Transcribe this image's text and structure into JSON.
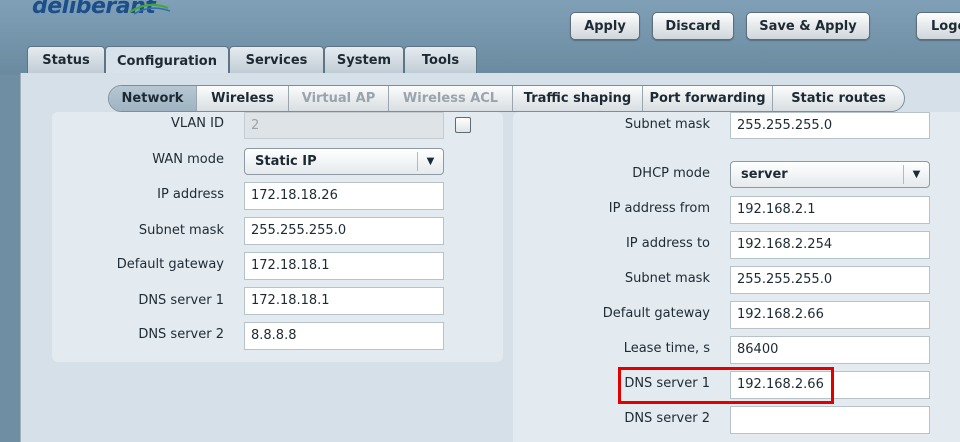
{
  "brand": {
    "logo_text": "deliberant"
  },
  "toolbar": {
    "apply_label": "Apply",
    "discard_label": "Discard",
    "save_apply_label": "Save & Apply",
    "logout_label": "Logo"
  },
  "main_tabs": [
    {
      "label": "Status"
    },
    {
      "label": "Configuration"
    },
    {
      "label": "Services"
    },
    {
      "label": "System"
    },
    {
      "label": "Tools"
    }
  ],
  "sub_tabs": [
    {
      "label": "Network"
    },
    {
      "label": "Wireless"
    },
    {
      "label": "Virtual AP"
    },
    {
      "label": "Wireless ACL"
    },
    {
      "label": "Traffic shaping"
    },
    {
      "label": "Port forwarding"
    },
    {
      "label": "Static routes"
    }
  ],
  "wan": {
    "vlan_id_label": "VLAN ID",
    "vlan_id_value": "2",
    "wan_mode_label": "WAN mode",
    "wan_mode_value": "Static IP",
    "ip_label": "IP address",
    "ip_value": "172.18.18.26",
    "mask_label": "Subnet mask",
    "mask_value": "255.255.255.0",
    "gateway_label": "Default gateway",
    "gateway_value": "172.18.18.1",
    "dns1_label": "DNS server 1",
    "dns1_value": "172.18.18.1",
    "dns2_label": "DNS server 2",
    "dns2_value": "8.8.8.8"
  },
  "lan": {
    "mask_label": "Subnet mask",
    "mask_value": "255.255.255.0",
    "dhcp_mode_label": "DHCP mode",
    "dhcp_mode_value": "server",
    "ip_from_label": "IP address from",
    "ip_from_value": "192.168.2.1",
    "ip_to_label": "IP address to",
    "ip_to_value": "192.168.2.254",
    "dhcp_mask_label": "Subnet mask",
    "dhcp_mask_value": "255.255.255.0",
    "gateway_label": "Default gateway",
    "gateway_value": "192.168.2.66",
    "lease_label": "Lease time, s",
    "lease_value": "86400",
    "dns1_label": "DNS server 1",
    "dns1_value": "192.168.2.66",
    "dns2_label": "DNS server 2",
    "dns2_value": ""
  },
  "colors": {
    "highlight": "#e00000",
    "brand": "#1b4e8a"
  }
}
